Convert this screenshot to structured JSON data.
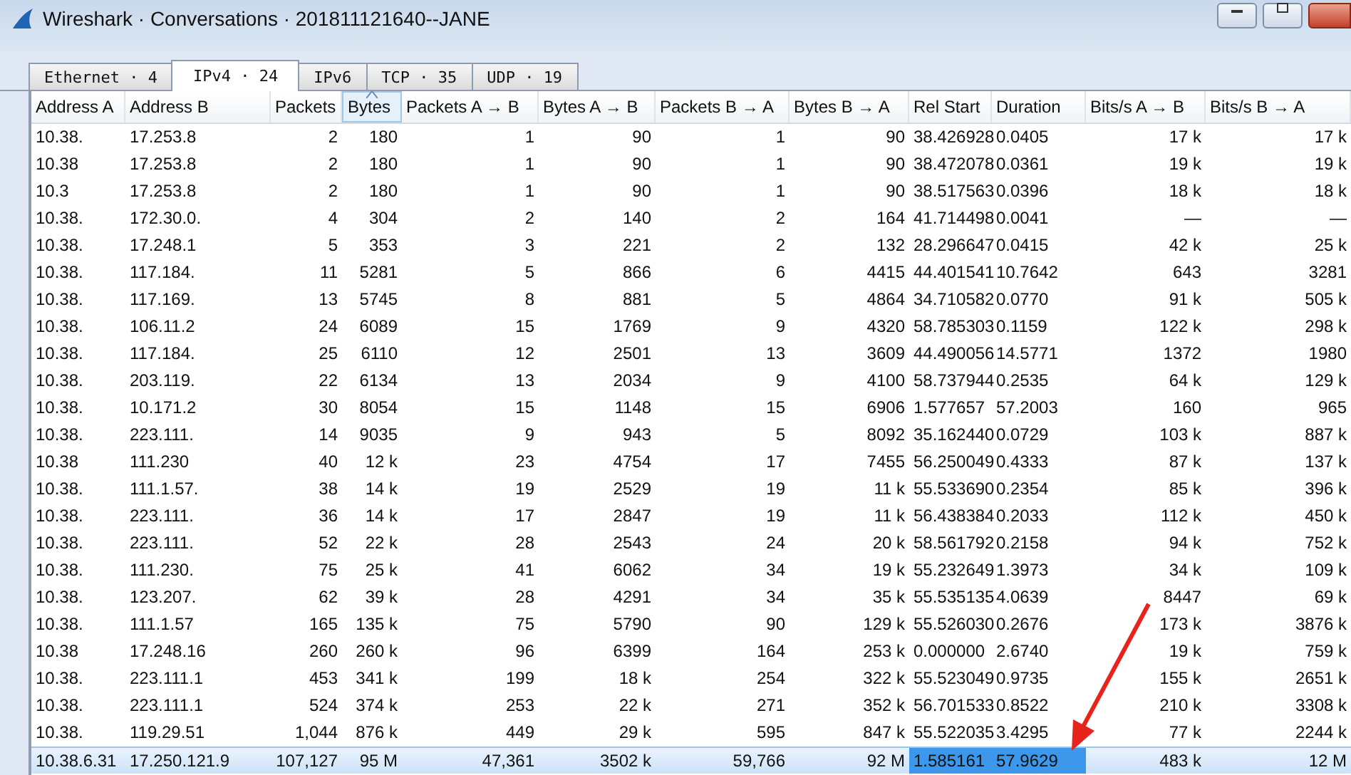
{
  "window": {
    "title": "Wireshark · Conversations · 201811121640--JANE"
  },
  "tabs": [
    {
      "label": "Ethernet · 4",
      "selected": false
    },
    {
      "label": "IPv4 · 24",
      "selected": true
    },
    {
      "label": "IPv6",
      "selected": false
    },
    {
      "label": "TCP · 35",
      "selected": false
    },
    {
      "label": "UDP · 19",
      "selected": false
    }
  ],
  "table": {
    "columns": [
      {
        "label": "Address A",
        "kind": "text",
        "sorted": false
      },
      {
        "label": "Address B",
        "kind": "text",
        "sorted": false
      },
      {
        "label": "Packets",
        "kind": "number",
        "sorted": false
      },
      {
        "label": "Bytes",
        "kind": "number",
        "sorted": true
      },
      {
        "label": "Packets A → B",
        "kind": "number",
        "sorted": false
      },
      {
        "label": "Bytes A → B",
        "kind": "number",
        "sorted": false
      },
      {
        "label": "Packets B → A",
        "kind": "number",
        "sorted": false
      },
      {
        "label": "Bytes B → A",
        "kind": "number",
        "sorted": false
      },
      {
        "label": "Rel Start",
        "kind": "time",
        "sorted": false
      },
      {
        "label": "Duration",
        "kind": "time",
        "sorted": false
      },
      {
        "label": "Bits/s A → B",
        "kind": "number",
        "sorted": false
      },
      {
        "label": "Bits/s B → A",
        "kind": "number",
        "sorted": false
      }
    ],
    "rows": [
      {
        "selected": false,
        "cells": [
          "10.38.",
          "17.253.8",
          "2",
          "180",
          "1",
          "90",
          "1",
          "90",
          "38.426928",
          "0.0405",
          "17 k",
          "17 k"
        ]
      },
      {
        "selected": false,
        "cells": [
          "10.38",
          "17.253.8",
          "2",
          "180",
          "1",
          "90",
          "1",
          "90",
          "38.472078",
          "0.0361",
          "19 k",
          "19 k"
        ]
      },
      {
        "selected": false,
        "cells": [
          "10.3",
          "17.253.8",
          "2",
          "180",
          "1",
          "90",
          "1",
          "90",
          "38.517563",
          "0.0396",
          "18 k",
          "18 k"
        ]
      },
      {
        "selected": false,
        "cells": [
          "10.38.",
          "172.30.0.",
          "4",
          "304",
          "2",
          "140",
          "2",
          "164",
          "41.714498",
          "0.0041",
          "—",
          "—"
        ]
      },
      {
        "selected": false,
        "cells": [
          "10.38.",
          "17.248.1",
          "5",
          "353",
          "3",
          "221",
          "2",
          "132",
          "28.296647",
          "0.0415",
          "42 k",
          "25 k"
        ]
      },
      {
        "selected": false,
        "cells": [
          "10.38.",
          "117.184.",
          "11",
          "5281",
          "5",
          "866",
          "6",
          "4415",
          "44.401541",
          "10.7642",
          "643",
          "3281"
        ]
      },
      {
        "selected": false,
        "cells": [
          "10.38.",
          "117.169.",
          "13",
          "5745",
          "8",
          "881",
          "5",
          "4864",
          "34.710582",
          "0.0770",
          "91 k",
          "505 k"
        ]
      },
      {
        "selected": false,
        "cells": [
          "10.38.",
          "106.11.2",
          "24",
          "6089",
          "15",
          "1769",
          "9",
          "4320",
          "58.785303",
          "0.1159",
          "122 k",
          "298 k"
        ]
      },
      {
        "selected": false,
        "cells": [
          "10.38.",
          "117.184.",
          "25",
          "6110",
          "12",
          "2501",
          "13",
          "3609",
          "44.490056",
          "14.5771",
          "1372",
          "1980"
        ]
      },
      {
        "selected": false,
        "cells": [
          "10.38.",
          "203.119.",
          "22",
          "6134",
          "13",
          "2034",
          "9",
          "4100",
          "58.737944",
          "0.2535",
          "64 k",
          "129 k"
        ]
      },
      {
        "selected": false,
        "cells": [
          "10.38.",
          "10.171.2",
          "30",
          "8054",
          "15",
          "1148",
          "15",
          "6906",
          "1.577657",
          "57.2003",
          "160",
          "965"
        ]
      },
      {
        "selected": false,
        "cells": [
          "10.38.",
          "223.111.",
          "14",
          "9035",
          "9",
          "943",
          "5",
          "8092",
          "35.162440",
          "0.0729",
          "103 k",
          "887 k"
        ]
      },
      {
        "selected": false,
        "cells": [
          "10.38",
          "111.230",
          "40",
          "12 k",
          "23",
          "4754",
          "17",
          "7455",
          "56.250049",
          "0.4333",
          "87 k",
          "137 k"
        ]
      },
      {
        "selected": false,
        "cells": [
          "10.38.",
          "111.1.57.",
          "38",
          "14 k",
          "19",
          "2529",
          "19",
          "11 k",
          "55.533690",
          "0.2354",
          "85 k",
          "396 k"
        ]
      },
      {
        "selected": false,
        "cells": [
          "10.38.",
          "223.111.",
          "36",
          "14 k",
          "17",
          "2847",
          "19",
          "11 k",
          "56.438384",
          "0.2033",
          "112 k",
          "450 k"
        ]
      },
      {
        "selected": false,
        "cells": [
          "10.38.",
          "223.111.",
          "52",
          "22 k",
          "28",
          "2543",
          "24",
          "20 k",
          "58.561792",
          "0.2158",
          "94 k",
          "752 k"
        ]
      },
      {
        "selected": false,
        "cells": [
          "10.38.",
          "111.230.",
          "75",
          "25 k",
          "41",
          "6062",
          "34",
          "19 k",
          "55.232649",
          "1.3973",
          "34 k",
          "109 k"
        ]
      },
      {
        "selected": false,
        "cells": [
          "10.38.",
          "123.207.",
          "62",
          "39 k",
          "28",
          "4291",
          "34",
          "35 k",
          "55.535135",
          "4.0639",
          "8447",
          "69 k"
        ]
      },
      {
        "selected": false,
        "cells": [
          "10.38.",
          "111.1.57",
          "165",
          "135 k",
          "75",
          "5790",
          "90",
          "129 k",
          "55.526030",
          "0.2676",
          "173 k",
          "3876 k"
        ]
      },
      {
        "selected": false,
        "cells": [
          "10.38",
          "17.248.16",
          "260",
          "260 k",
          "96",
          "6399",
          "164",
          "253 k",
          "0.000000",
          "2.6740",
          "19 k",
          "759 k"
        ]
      },
      {
        "selected": false,
        "cells": [
          "10.38.",
          "223.111.1",
          "453",
          "341 k",
          "199",
          "18 k",
          "254",
          "322 k",
          "55.523049",
          "0.9735",
          "155 k",
          "2651 k"
        ]
      },
      {
        "selected": false,
        "cells": [
          "10.38.",
          "223.111.1",
          "524",
          "374 k",
          "253",
          "22 k",
          "271",
          "352 k",
          "56.701533",
          "0.8522",
          "210 k",
          "3308 k"
        ]
      },
      {
        "selected": false,
        "cells": [
          "10.38.",
          "119.29.51",
          "1,044",
          "876 k",
          "449",
          "29 k",
          "595",
          "847 k",
          "55.522035",
          "3.4295",
          "77 k",
          "2244 k"
        ]
      },
      {
        "selected": true,
        "cells": [
          "10.38.6.31",
          "17.250.121.9",
          "107,127",
          "95 M",
          "47,361",
          "3502 k",
          "59,766",
          "92 M",
          "1.585161",
          "57.9629",
          "483 k",
          "12 M"
        ]
      }
    ]
  }
}
